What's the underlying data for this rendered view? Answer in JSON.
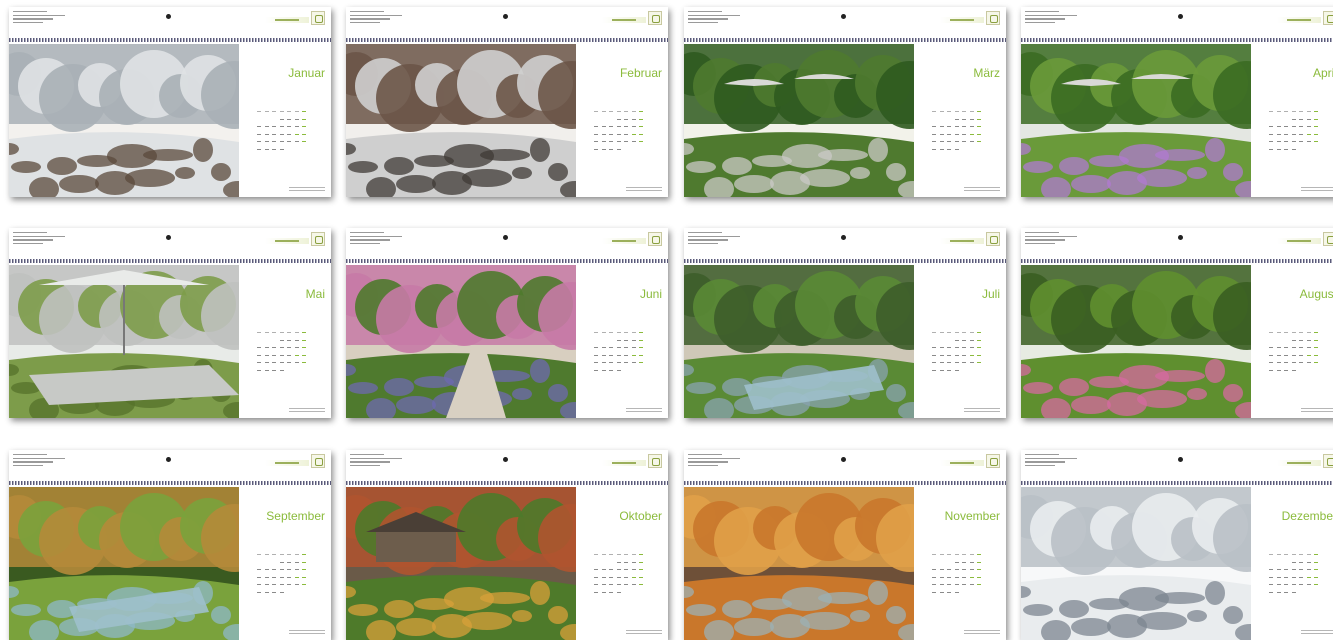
{
  "calendar": {
    "pages": [
      {
        "month": "Januar",
        "scene": "winter-rocks",
        "palette": [
          "#dfe2e4",
          "#a8b0b6",
          "#5b4a3c",
          "#f3f1ee"
        ]
      },
      {
        "month": "Februar",
        "scene": "winter-garden",
        "palette": [
          "#cfcfcf",
          "#6b5548",
          "#3f3a36",
          "#f1efec"
        ]
      },
      {
        "month": "März",
        "scene": "boxwood",
        "palette": [
          "#4f7a2f",
          "#2f5a1f",
          "#c9c9c6",
          "#f2f2ea"
        ]
      },
      {
        "month": "April",
        "scene": "spring-lawn",
        "palette": [
          "#6a9a3a",
          "#3b6b22",
          "#b07ad0",
          "#e4e7e2"
        ]
      },
      {
        "month": "Mai",
        "scene": "terrace",
        "palette": [
          "#7d9c4a",
          "#bfc1bf",
          "#56712b",
          "#e8ebe8"
        ]
      },
      {
        "month": "Juni",
        "scene": "flower-path",
        "palette": [
          "#4f7a2e",
          "#c77aa6",
          "#6e6ab0",
          "#d8cfc0"
        ]
      },
      {
        "month": "Juli",
        "scene": "pond",
        "palette": [
          "#5a8a35",
          "#3d5d2a",
          "#8aa3b0",
          "#cfc8b8"
        ]
      },
      {
        "month": "August",
        "scene": "lush-garden",
        "palette": [
          "#5f8f2f",
          "#3a5e21",
          "#d66aa0",
          "#e7ebe2"
        ]
      },
      {
        "month": "September",
        "scene": "grasses-pool",
        "palette": [
          "#7aa23c",
          "#b58a3a",
          "#8fb8c8",
          "#3a5a20"
        ]
      },
      {
        "month": "Oktober",
        "scene": "autumn-house",
        "palette": [
          "#4e7a2a",
          "#b0542f",
          "#d8a03a",
          "#6a5a48"
        ]
      },
      {
        "month": "November",
        "scene": "autumn-tree",
        "palette": [
          "#c9772b",
          "#e0a048",
          "#9cb0b4",
          "#6e5038"
        ]
      },
      {
        "month": "Dezember",
        "scene": "snow-garden",
        "palette": [
          "#e9ecee",
          "#b9c0c6",
          "#7c8590",
          "#f7f8f9"
        ]
      }
    ]
  }
}
